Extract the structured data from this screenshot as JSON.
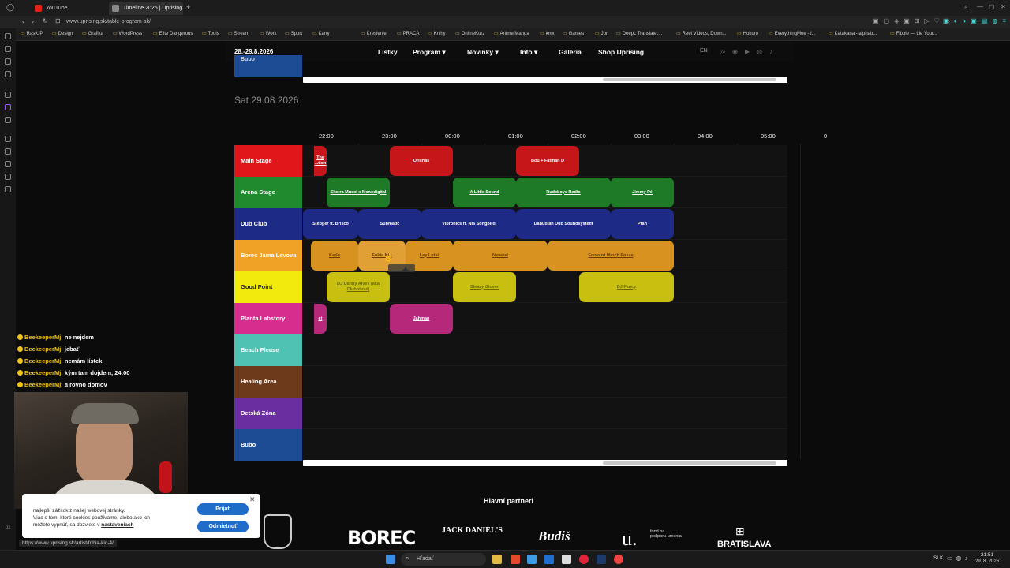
{
  "browser": {
    "tabs": [
      {
        "label": "YouTube",
        "color": "#e62117"
      },
      {
        "label": "Timeline 2026 | Uprising",
        "color": "#888888"
      }
    ],
    "url": "www.uprising.sk/table-program-sk/",
    "bookmarks": [
      "RastUP",
      "Design",
      "Grafika",
      "WordPress",
      "Elite Dangerous",
      "Tools",
      "Stream",
      "Work",
      "Sport",
      "Karty",
      "Kreslenie",
      "PRACA",
      "Knihy",
      "OnlineKurz",
      "Anime/Manga",
      "kmx",
      "Games",
      "Jpn",
      "DeepL Translate:...",
      "Reel Videos, Down...",
      "Hokuro",
      "EverythingMoe - I...",
      "Katakana - alphab...",
      "Fibble — Lie Your..."
    ],
    "status_url": "https://www.uprising.sk/artist/fobia-kid-4/"
  },
  "site": {
    "date_range": "28.-29.8.2026",
    "nav": [
      {
        "label": "Lístky"
      },
      {
        "label": "Program ▾"
      },
      {
        "label": "Novinky ▾"
      },
      {
        "label": "Info ▾"
      },
      {
        "label": "Galéria"
      },
      {
        "label": "Shop Uprising"
      }
    ],
    "lang": "EN",
    "prev_stage_label": "Bubo",
    "day_heading": "Sat 29.08.2026",
    "times": [
      "22:00",
      "23:00",
      "00:00",
      "01:00",
      "02:00",
      "03:00",
      "04:00",
      "05:00",
      "0"
    ],
    "stages": [
      {
        "name": "Main Stage",
        "color": "#e0161b"
      },
      {
        "name": "Arena Stage",
        "color": "#1f8a2e"
      },
      {
        "name": "Dub Club",
        "color": "#1d2a86"
      },
      {
        "name": "Borec Jama Levova",
        "color": "#f0a226"
      },
      {
        "name": "Good Point",
        "color": "#f2ea0d"
      },
      {
        "name": "Planta Labstory",
        "color": "#d72d8f"
      },
      {
        "name": "Beach Please",
        "color": "#4fc2b4"
      },
      {
        "name": "Healing Area",
        "color": "#6e3a1c"
      },
      {
        "name": "Detská Zóna",
        "color": "#6a2ea0"
      },
      {
        "name": "Bubo",
        "color": "#1e4c94"
      }
    ],
    "events": [
      {
        "stage": 0,
        "label": "The ...tion",
        "start": -0.2,
        "end": 0.0,
        "color": "#c6161a",
        "style": ""
      },
      {
        "stage": 0,
        "label": "Orishas",
        "start": 1.0,
        "end": 2.0,
        "color": "#c6161a",
        "style": ""
      },
      {
        "stage": 0,
        "label": "Bou + Fatman D",
        "start": 3.0,
        "end": 4.0,
        "color": "#c6161a",
        "style": ""
      },
      {
        "stage": 1,
        "label": "Skerra Mucci x Menodigital",
        "start": 0.0,
        "end": 1.0,
        "color": "#1f7a28",
        "style": ""
      },
      {
        "stage": 1,
        "label": "A Little Sound",
        "start": 2.0,
        "end": 3.0,
        "color": "#1f7a28",
        "style": ""
      },
      {
        "stage": 1,
        "label": "Rudeboys Radio",
        "start": 3.0,
        "end": 4.5,
        "color": "#1f7a28",
        "style": ""
      },
      {
        "stage": 1,
        "label": "Jimmy Pé",
        "start": 4.5,
        "end": 5.5,
        "color": "#1f7a28",
        "style": ""
      },
      {
        "stage": 2,
        "label": "Stepper ft. Brisco",
        "start": -0.4,
        "end": 0.5,
        "color": "#1d2a86",
        "style": ""
      },
      {
        "stage": 2,
        "label": "Submatic",
        "start": 0.5,
        "end": 1.5,
        "color": "#1d2a86",
        "style": ""
      },
      {
        "stage": 2,
        "label": "Vibronics ft. Nia Songbird",
        "start": 1.5,
        "end": 3.0,
        "color": "#1d2a86",
        "style": ""
      },
      {
        "stage": 2,
        "label": "Danubian Dub Soundsystem",
        "start": 3.0,
        "end": 4.5,
        "color": "#1d2a86",
        "style": ""
      },
      {
        "stage": 2,
        "label": "Ptah",
        "start": 4.5,
        "end": 5.5,
        "color": "#1d2a86",
        "style": ""
      },
      {
        "stage": 3,
        "label": "Karlo",
        "start": -0.25,
        "end": 0.5,
        "color": "#d89220",
        "style": "dark"
      },
      {
        "stage": 3,
        "label": "Fobia Kid",
        "start": 0.5,
        "end": 1.25,
        "color": "#e0a035",
        "style": "dark"
      },
      {
        "stage": 3,
        "label": "Ley Lotai",
        "start": 1.25,
        "end": 2.0,
        "color": "#d89220",
        "style": "dark"
      },
      {
        "stage": 3,
        "label": "Neverel",
        "start": 2.0,
        "end": 3.5,
        "color": "#d89220",
        "style": "dark"
      },
      {
        "stage": 3,
        "label": "Forward March Posse",
        "start": 3.5,
        "end": 5.5,
        "color": "#d89220",
        "style": "dark"
      },
      {
        "stage": 4,
        "label": "DJ Danny Alves (aka Clubobovi)",
        "start": 0.0,
        "end": 1.0,
        "color": "#c8bf10",
        "style": "dark2"
      },
      {
        "stage": 4,
        "label": "Sleazy Glover",
        "start": 2.0,
        "end": 3.0,
        "color": "#c8bf10",
        "style": "dark2"
      },
      {
        "stage": 4,
        "label": "DJ Fancy",
        "start": 4.0,
        "end": 5.5,
        "color": "#c8bf10",
        "style": "dark2"
      },
      {
        "stage": 5,
        "label": "et",
        "start": -0.2,
        "end": 0.0,
        "color": "#b5287a",
        "style": ""
      },
      {
        "stage": 5,
        "label": "Jahman",
        "start": 1.0,
        "end": 2.0,
        "color": "#b5287a",
        "style": ""
      }
    ],
    "partners_heading": "Hlavní partneri",
    "partners": [
      "BOREC",
      "JACK DANIEL'S",
      "Budiš",
      "fond na podporu umenia",
      "BRATISLAVA"
    ]
  },
  "chat": [
    {
      "user": "BeekeeperMj",
      "text": "ne nejdem"
    },
    {
      "user": "BeekeeperMj",
      "text": "jebať"
    },
    {
      "user": "BeekeeperMj",
      "text": "nemám lístek"
    },
    {
      "user": "BeekeeperMj",
      "text": "kým tam dojdem, 24:00"
    },
    {
      "user": "BeekeeperMj",
      "text": "a rovno domov"
    }
  ],
  "cookie": {
    "text1": "najlepší zážitok z našej webovej stránky.",
    "text2": "Viac o tom, ktoré cookies používame, alebo ako ich",
    "text3": "môžete vypnúť, sa dozviete v",
    "link": "nastaveniach",
    "accept": "Prijať",
    "decline": "Odmietnuť"
  },
  "taskbar": {
    "search": "Hľadať",
    "lang": "SLK",
    "time": "21:51",
    "date": "29. 8. 2026"
  }
}
